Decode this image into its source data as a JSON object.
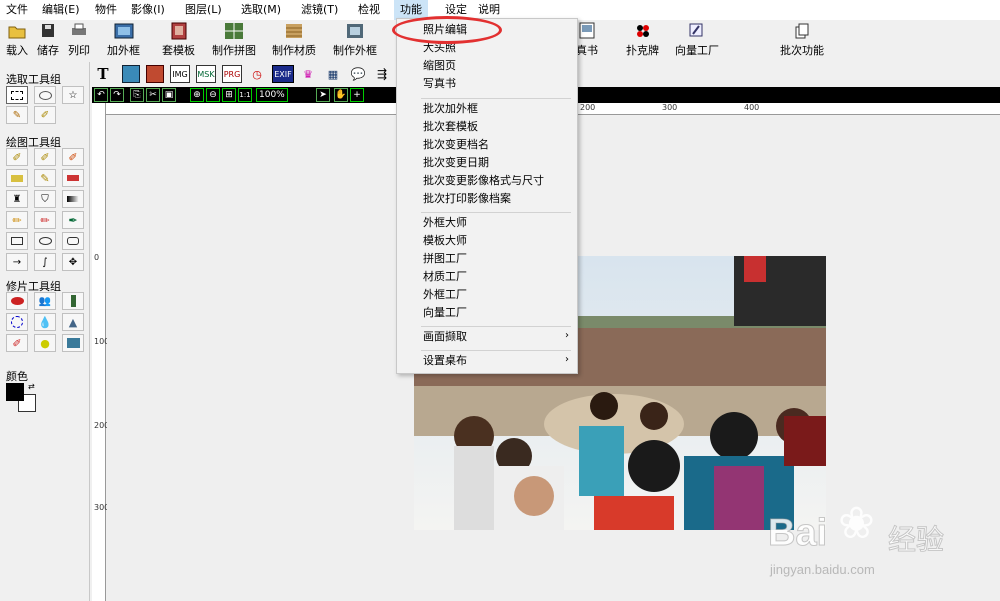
{
  "menubar": {
    "items": [
      "文件",
      "编辑(E)",
      "物件",
      "影像(I)",
      "图层(L)",
      "选取(M)",
      "滤镜(T)",
      "检视",
      "功能",
      "设定",
      "说明"
    ]
  },
  "toolbar": {
    "open": "载入",
    "save": "储存",
    "print": "列印",
    "add_frame": "加外框",
    "template": "套模板",
    "collage": "制作拼图",
    "material": "制作材质",
    "outer_frame": "制作外框",
    "book": "真书",
    "poker": "扑克牌",
    "vector_factory": "向量工厂",
    "batch": "批次功能"
  },
  "left_panel": {
    "select_group": "选取工具组",
    "draw_group": "绘图工具组",
    "retouch_group": "修片工具组",
    "color_label": "颜色"
  },
  "toolbar2": {
    "text_tool": "T",
    "labels": [
      "IMG",
      "MSK",
      "PRG",
      "EXIF"
    ]
  },
  "darkbar": {
    "zoom": "100%"
  },
  "rulers": {
    "h_labels": [
      "200",
      "300",
      "400"
    ],
    "v_labels": [
      "0",
      "100",
      "200",
      "300"
    ]
  },
  "dropdown": {
    "items": [
      {
        "label": "照片编辑"
      },
      {
        "label": "大头照"
      },
      {
        "label": "缩图页"
      },
      {
        "label": "写真书"
      },
      {
        "label": "批次加外框"
      },
      {
        "label": "批次套模板"
      },
      {
        "label": "批次变更档名"
      },
      {
        "label": "批次变更日期"
      },
      {
        "label": "批次变更影像格式与尺寸"
      },
      {
        "label": "批次打印影像档案"
      },
      {
        "label": "外框大师"
      },
      {
        "label": "模板大师"
      },
      {
        "label": "拼图工厂"
      },
      {
        "label": "材质工厂"
      },
      {
        "label": "外框工厂"
      },
      {
        "label": "向量工厂"
      },
      {
        "label": "画面撷取",
        "submenu": true
      },
      {
        "label": "设置桌布",
        "submenu": true
      }
    ]
  },
  "watermark": {
    "brand": "Bai",
    "brand2": "经验",
    "url": "jingyan.baidu.com"
  },
  "colors": {
    "accent": "#e23030",
    "menu_highlight": "#cce4f7"
  }
}
